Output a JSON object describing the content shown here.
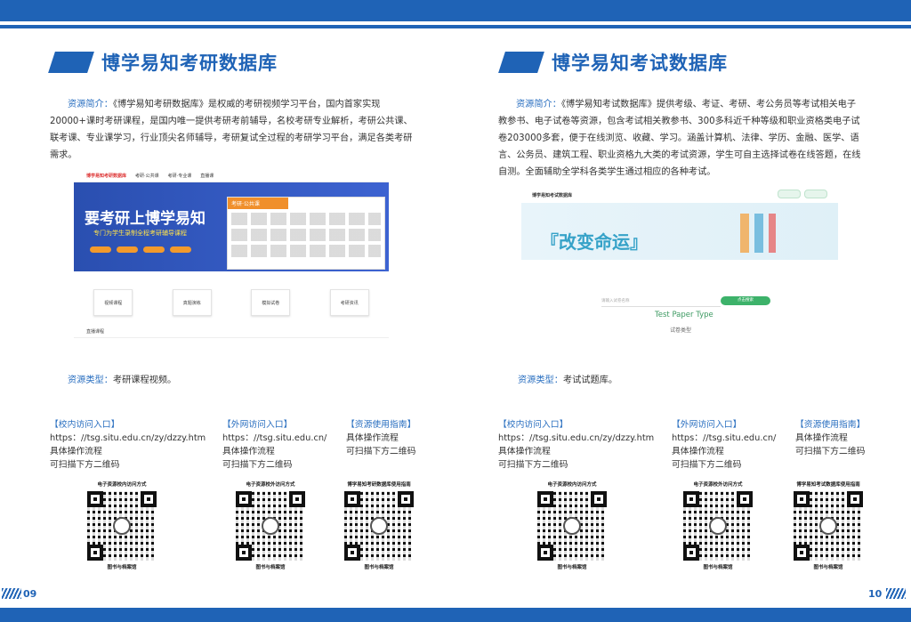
{
  "left": {
    "title": "博学易知考研数据库",
    "intro_label": "资源简介：",
    "intro_text": "《博学易知考研数据库》是权威的考研视频学习平台，国内首家实现20000+课时考研课程，是国内唯一提供考研考前辅导，名校考研专业解析，考研公共课、联考课、专业课学习，行业顶尖名师辅导，考研复试全过程的考研学习平台，满足各类考研需求。",
    "shot": {
      "logo": "博学易知考研数据库",
      "nav": [
        "考研·公共课",
        "考研·专业课",
        "直播课"
      ],
      "banner_big": "要考研上博学易知",
      "banner_sub": "专门为学生录制全程考研辅导课程",
      "panel_head": "考研·公共课",
      "cards": [
        "视频课程",
        "真题演练",
        "模拟试卷",
        "考研资讯"
      ],
      "live": "直播课程"
    },
    "restype_label": "资源类型：",
    "restype_text": "考研课程视频。",
    "cols": [
      {
        "head": "【校内访问入口】",
        "lines": [
          "https：//tsg.situ.edu.cn/zy/dzzy.htm",
          "具体操作流程",
          "可扫描下方二维码"
        ]
      },
      {
        "head": "【外网访问入口】",
        "lines": [
          "https：//tsg.situ.edu.cn/",
          "具体操作流程",
          "可扫描下方二维码"
        ]
      },
      {
        "head": "【资源使用指南】",
        "lines": [
          "具体操作流程",
          "可扫描下方二维码"
        ]
      }
    ],
    "qrs": [
      {
        "cap": "电子资源校内访问方式",
        "foot": "图书与档案馆"
      },
      {
        "cap": "电子资源校外访问方式",
        "foot": "图书与档案馆"
      },
      {
        "cap": "博学易知考研数据库使用指南",
        "foot": "图书与档案馆"
      }
    ],
    "page_number": "09"
  },
  "right": {
    "title": "博学易知考试数据库",
    "intro_label": "资源简介：",
    "intro_text": "《博学易知考试数据库》提供考级、考证、考研、考公务员等考试相关电子教参书、电子试卷等资源，包含考试相关教参书、300多科近千种等级和职业资格类电子试卷203000多套，便于在线浏览、收藏、学习。涵盖计算机、法律、学历、金融、医学、语言、公务员、建筑工程、职业资格九大类的考试资源，学生可自主选择试卷在线答题，在线自测。全面辅助全学科各类学生通过相应的各种考试。",
    "shot": {
      "logo": "博学易知考试数据库",
      "banner_big": "『改变命运』",
      "search_placeholder": "请输入试卷名称",
      "search_button": "点击搜索"
    },
    "test_paper_type": "Test Paper Type",
    "test_paper_type_cn": "试卷类型",
    "restype_label": "资源类型：",
    "restype_text": "考试试题库。",
    "cols": [
      {
        "head": "【校内访问入口】",
        "lines": [
          "https：//tsg.situ.edu.cn/zy/dzzy.htm",
          "具体操作流程",
          "可扫描下方二维码"
        ]
      },
      {
        "head": "【外网访问入口】",
        "lines": [
          "https：//tsg.situ.edu.cn/",
          "具体操作流程",
          "可扫描下方二维码"
        ]
      },
      {
        "head": "【资源使用指南】",
        "lines": [
          "具体操作流程",
          "可扫描下方二维码"
        ]
      }
    ],
    "qrs": [
      {
        "cap": "电子资源校内访问方式",
        "foot": "图书与档案馆"
      },
      {
        "cap": "电子资源校外访问方式",
        "foot": "图书与档案馆"
      },
      {
        "cap": "博学易知考试数据库使用指南",
        "foot": "图书与档案馆"
      }
    ],
    "page_number": "10"
  }
}
